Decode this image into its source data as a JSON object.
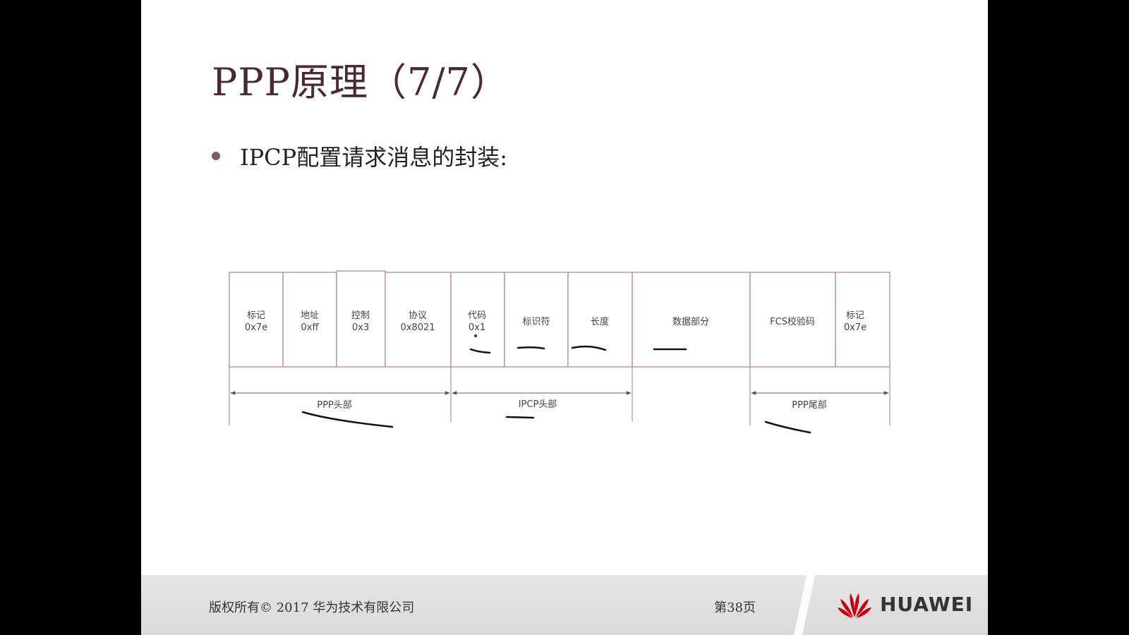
{
  "slide": {
    "title": "PPP原理（7/7）",
    "bullet": "IPCP配置请求消息的封装:"
  },
  "frame_fields": [
    {
      "name": "标记",
      "value": "0x7e"
    },
    {
      "name": "地址",
      "value": "0xff"
    },
    {
      "name": "控制",
      "value": "0x3"
    },
    {
      "name": "协议",
      "value": "0x8021"
    },
    {
      "name": "代码",
      "value": "0x1"
    },
    {
      "name": "标识符",
      "value": ""
    },
    {
      "name": "长度",
      "value": ""
    },
    {
      "name": "数据部分",
      "value": ""
    },
    {
      "name": "FCS校验码",
      "value": ""
    },
    {
      "name": "标记",
      "value": "0x7e"
    }
  ],
  "spans": [
    {
      "label": "PPP头部"
    },
    {
      "label": "IPCP头部"
    },
    {
      "label": "PPP尾部"
    }
  ],
  "footer": {
    "copyright": "版权所有© 2017 华为技术有限公司",
    "page": "第38页",
    "logo_text": "HUAWEI"
  },
  "colors": {
    "title": "#4a2a30",
    "cell_border": "#b89aa0",
    "logo_red": "#c7000b"
  }
}
